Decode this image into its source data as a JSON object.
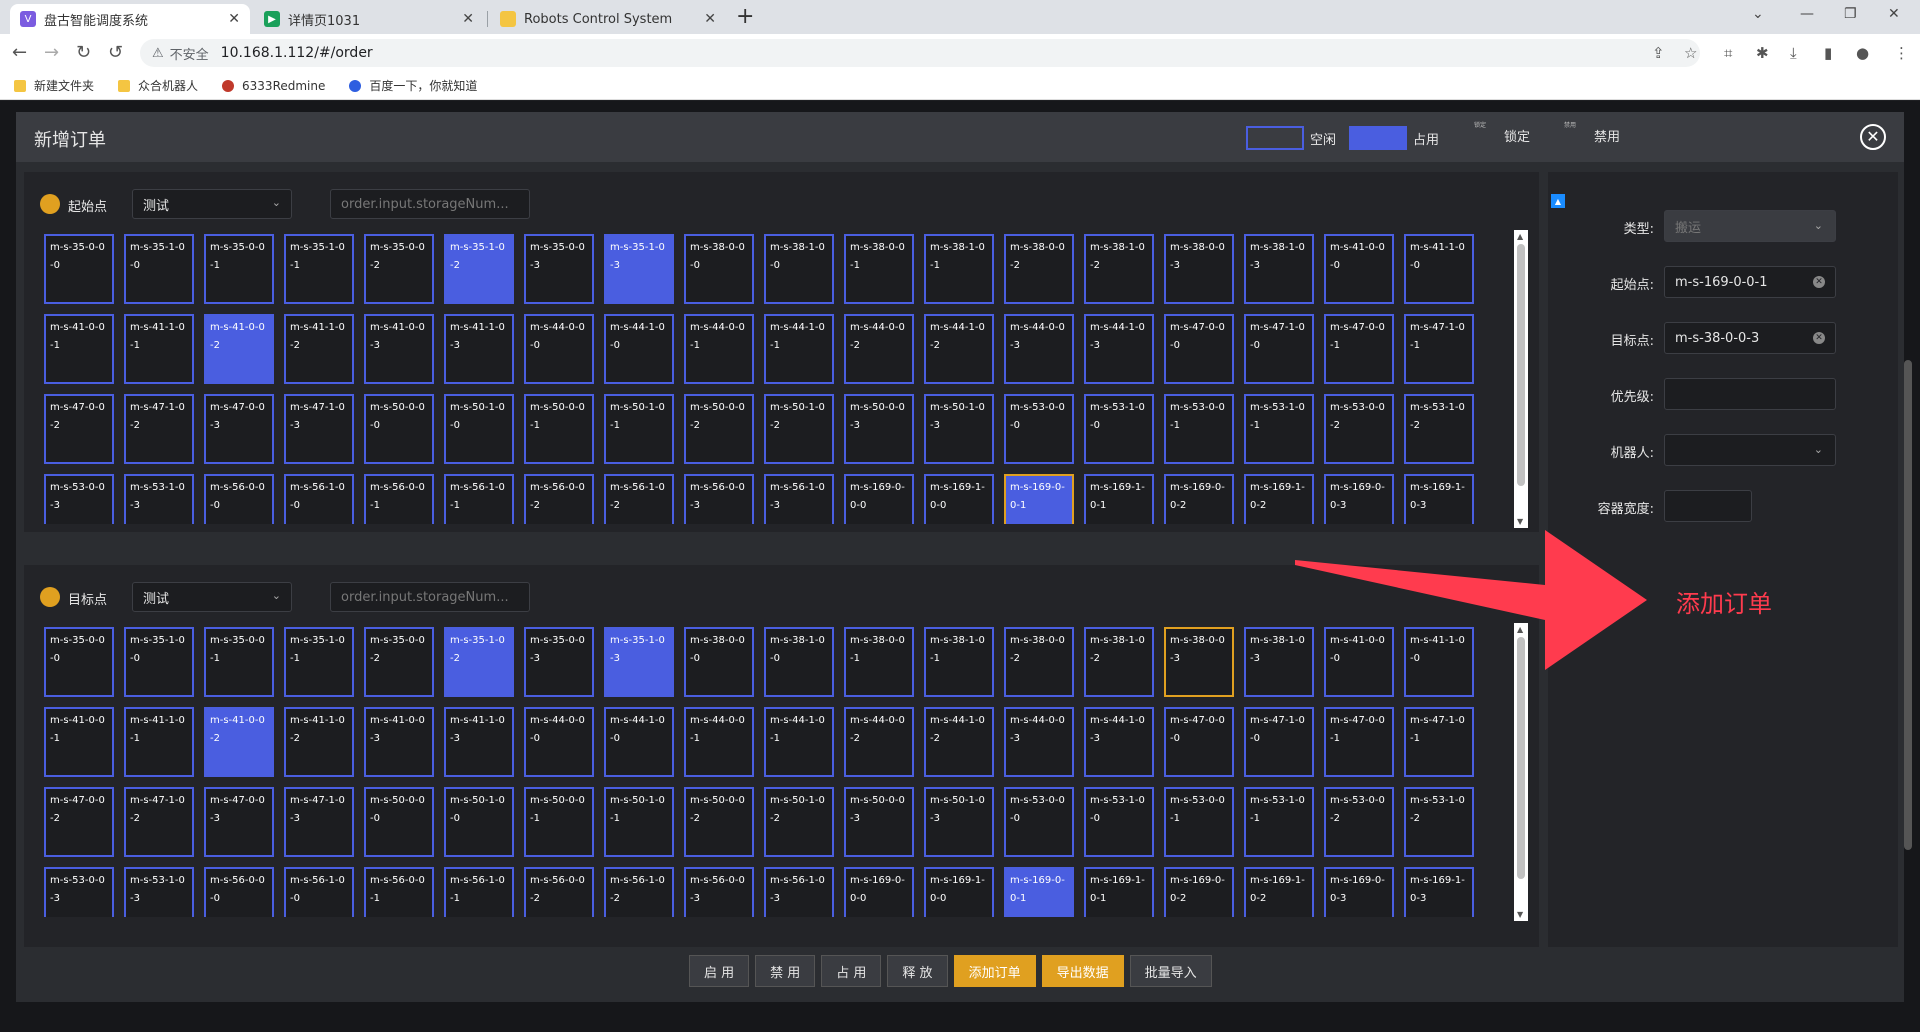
{
  "browser": {
    "tabs": [
      {
        "title": "盘古智能调度系统",
        "active": true
      },
      {
        "title": "详情页1031",
        "active": false
      },
      {
        "title": "Robots Control System",
        "active": false
      }
    ],
    "insecure_label": "不安全",
    "url": "10.168.1.112/#/order",
    "bookmarks": [
      "新建文件夹",
      "众合机器人",
      "6333Redmine",
      "百度一下，你就知道"
    ]
  },
  "modal": {
    "title": "新增订单",
    "legend": [
      {
        "label": "空闲",
        "style": "outline"
      },
      {
        "label": "占用",
        "style": "fill"
      },
      {
        "label": "锁定",
        "style": "none"
      },
      {
        "label": "禁用",
        "style": "none"
      }
    ],
    "legend_tiny": [
      "锁定",
      "禁用"
    ],
    "colors": {
      "free": "#4a5ee0",
      "occupied": "#4a5ee0",
      "selected": "#e0a020",
      "accent": "#e0a020",
      "annotation": "#ff3b4e"
    }
  },
  "start_panel": {
    "label": "起始点",
    "select_value": "测试",
    "search_placeholder": "order.input.storageNum...",
    "selected": "m-s-169-0-0-1",
    "occupied": [
      "m-s-35-1-0-2",
      "m-s-35-1-0-3",
      "m-s-41-0-0-2",
      "m-s-169-0-0-1"
    ]
  },
  "target_panel": {
    "label": "目标点",
    "select_value": "测试",
    "search_placeholder": "order.input.storageNum...",
    "selected": "m-s-38-0-0-3",
    "occupied": [
      "m-s-35-1-0-2",
      "m-s-35-1-0-3",
      "m-s-41-0-0-2",
      "m-s-169-0-0-1"
    ]
  },
  "cells": [
    "m-s-35-0-0-0",
    "m-s-35-1-0-0",
    "m-s-35-0-0-1",
    "m-s-35-1-0-1",
    "m-s-35-0-0-2",
    "m-s-35-1-0-2",
    "m-s-35-0-0-3",
    "m-s-35-1-0-3",
    "m-s-38-0-0-0",
    "m-s-38-1-0-0",
    "m-s-38-0-0-1",
    "m-s-38-1-0-1",
    "m-s-38-0-0-2",
    "m-s-38-1-0-2",
    "m-s-38-0-0-3",
    "m-s-38-1-0-3",
    "m-s-41-0-0-0",
    "m-s-41-1-0-0",
    "m-s-41-0-0-1",
    "m-s-41-1-0-1",
    "m-s-41-0-0-2",
    "m-s-41-1-0-2",
    "m-s-41-0-0-3",
    "m-s-41-1-0-3",
    "m-s-44-0-0-0",
    "m-s-44-1-0-0",
    "m-s-44-0-0-1",
    "m-s-44-1-0-1",
    "m-s-44-0-0-2",
    "m-s-44-1-0-2",
    "m-s-44-0-0-3",
    "m-s-44-1-0-3",
    "m-s-47-0-0-0",
    "m-s-47-1-0-0",
    "m-s-47-0-0-1",
    "m-s-47-1-0-1",
    "m-s-47-0-0-2",
    "m-s-47-1-0-2",
    "m-s-47-0-0-3",
    "m-s-47-1-0-3",
    "m-s-50-0-0-0",
    "m-s-50-1-0-0",
    "m-s-50-0-0-1",
    "m-s-50-1-0-1",
    "m-s-50-0-0-2",
    "m-s-50-1-0-2",
    "m-s-50-0-0-3",
    "m-s-50-1-0-3",
    "m-s-53-0-0-0",
    "m-s-53-1-0-0",
    "m-s-53-0-0-1",
    "m-s-53-1-0-1",
    "m-s-53-0-0-2",
    "m-s-53-1-0-2",
    "m-s-53-0-0-3",
    "m-s-53-1-0-3",
    "m-s-56-0-0-0",
    "m-s-56-1-0-0",
    "m-s-56-0-0-1",
    "m-s-56-1-0-1",
    "m-s-56-0-0-2",
    "m-s-56-1-0-2",
    "m-s-56-0-0-3",
    "m-s-56-1-0-3",
    "m-s-169-0-0-0",
    "m-s-169-1-0-0",
    "m-s-169-0-0-1",
    "m-s-169-1-0-1",
    "m-s-169-0-0-2",
    "m-s-169-1-0-2",
    "m-s-169-0-0-3",
    "m-s-169-1-0-3"
  ],
  "form": {
    "type_label": "类型:",
    "type_value": "搬运",
    "start_label": "起始点:",
    "start_value": "m-s-169-0-0-1",
    "target_label": "目标点:",
    "target_value": "m-s-38-0-0-3",
    "priority_label": "优先级:",
    "robot_label": "机器人:",
    "width_label": "容器宽度:"
  },
  "annotation": "添加订单",
  "buttons": [
    {
      "label": "启 用",
      "style": "default"
    },
    {
      "label": "禁 用",
      "style": "default"
    },
    {
      "label": "占 用",
      "style": "default"
    },
    {
      "label": "释 放",
      "style": "default"
    },
    {
      "label": "添加订单",
      "style": "warm"
    },
    {
      "label": "导出数据",
      "style": "warm"
    },
    {
      "label": "批量导入",
      "style": "default"
    }
  ]
}
